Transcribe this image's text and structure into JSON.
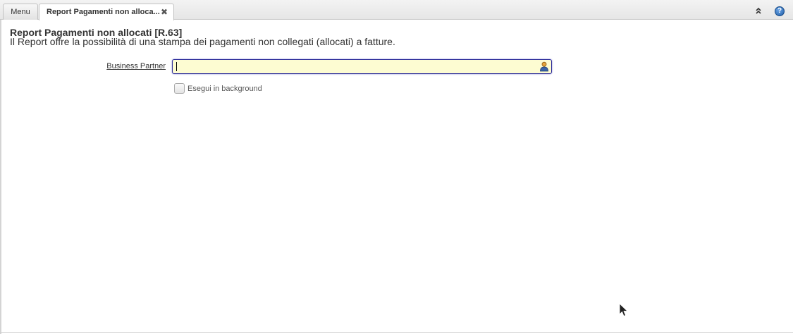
{
  "tabs": {
    "menu_label": "Menu",
    "report_label": "Report Pagamenti non alloca...",
    "close_glyph": "✖"
  },
  "toolbar": {
    "collapse_icon": "double-chevron-up-icon",
    "help_glyph": "?"
  },
  "page": {
    "title": "Report Pagamenti non allocati [R.63]",
    "description": "Il Report offre la possibilità di una stampa dei pagamenti non collegati (allocati) a fatture."
  },
  "form": {
    "business_partner_label": "Business Partner",
    "business_partner_value": "",
    "business_partner_icon": "person-lookup-icon",
    "background_label": "Esegui in background",
    "background_checked": false
  },
  "colors": {
    "field_background": "#fdfcd2",
    "field_border": "#2d2d9a",
    "help_blue": "#1f5ea8"
  }
}
